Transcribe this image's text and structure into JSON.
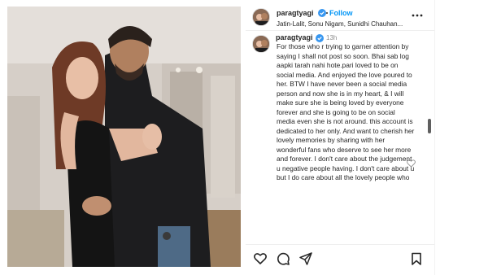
{
  "post": {
    "username": "paragtyagi",
    "follow_label": "Follow",
    "audio_subtitle": "Jatin-Lalit, Sonu Nigam, Sunidhi Chauhan...",
    "comment": {
      "username": "paragtyagi",
      "time": "13h",
      "caption": "For those who r trying to garner attention by saying I shall not post so soon. Bhai sab log aapki tarah nahi hote.pari loved to be on social media. And enjoyed the love poured to her. BTW I have never been a social media person and now she is in my heart, & I will make sure she is being loved by everyone forever and she is going to be on social media even she is not around. this account is dedicated to her only. And want to cherish her lovely memories by sharing with her wonderful fans who deserve to see her more and forever. I don't care about the judgement u negative people having. I don't care about u but I do care about all the lovely people who"
    },
    "colors": {
      "link_blue": "#0095f6",
      "verified_blue": "#3897f0",
      "text": "#262626",
      "muted": "#8e8e8e"
    },
    "icons": [
      "more-icon",
      "verified-icon",
      "heart-icon",
      "comment-icon",
      "share-icon",
      "save-icon"
    ]
  }
}
